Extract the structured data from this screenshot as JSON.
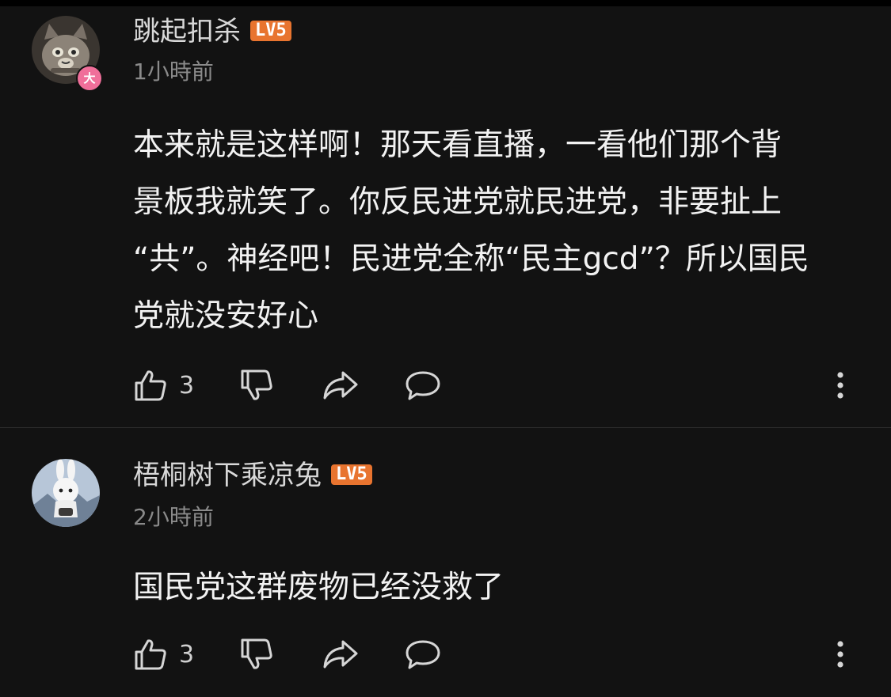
{
  "comments": [
    {
      "username": "跳起扣杀",
      "level": "LV5",
      "avatar_badge": "大",
      "time": "1小時前",
      "text_lines": [
        "本来就是这样啊！那天看直播，一看他们那个背",
        "景板我就笑了。你反民进党就民进党，非要扯上",
        "“共”。神经吧！民进党全称“民主gcd”？所以国民",
        "党就没安好心"
      ],
      "likes": "3",
      "icons": [
        "thumbs-up-icon",
        "thumbs-down-icon",
        "share-icon",
        "comment-icon",
        "more-vertical-icon"
      ]
    },
    {
      "username": "梧桐树下乘凉兔",
      "level": "LV5",
      "time": "2小時前",
      "text_lines": [
        "国民党这群废物已经没救了"
      ],
      "likes": "3",
      "icons": [
        "thumbs-up-icon",
        "thumbs-down-icon",
        "share-icon",
        "comment-icon",
        "more-vertical-icon"
      ]
    }
  ],
  "colors": {
    "background": "#121212",
    "level_badge": "#e8742f",
    "avatar_badge": "#f06f9a"
  }
}
